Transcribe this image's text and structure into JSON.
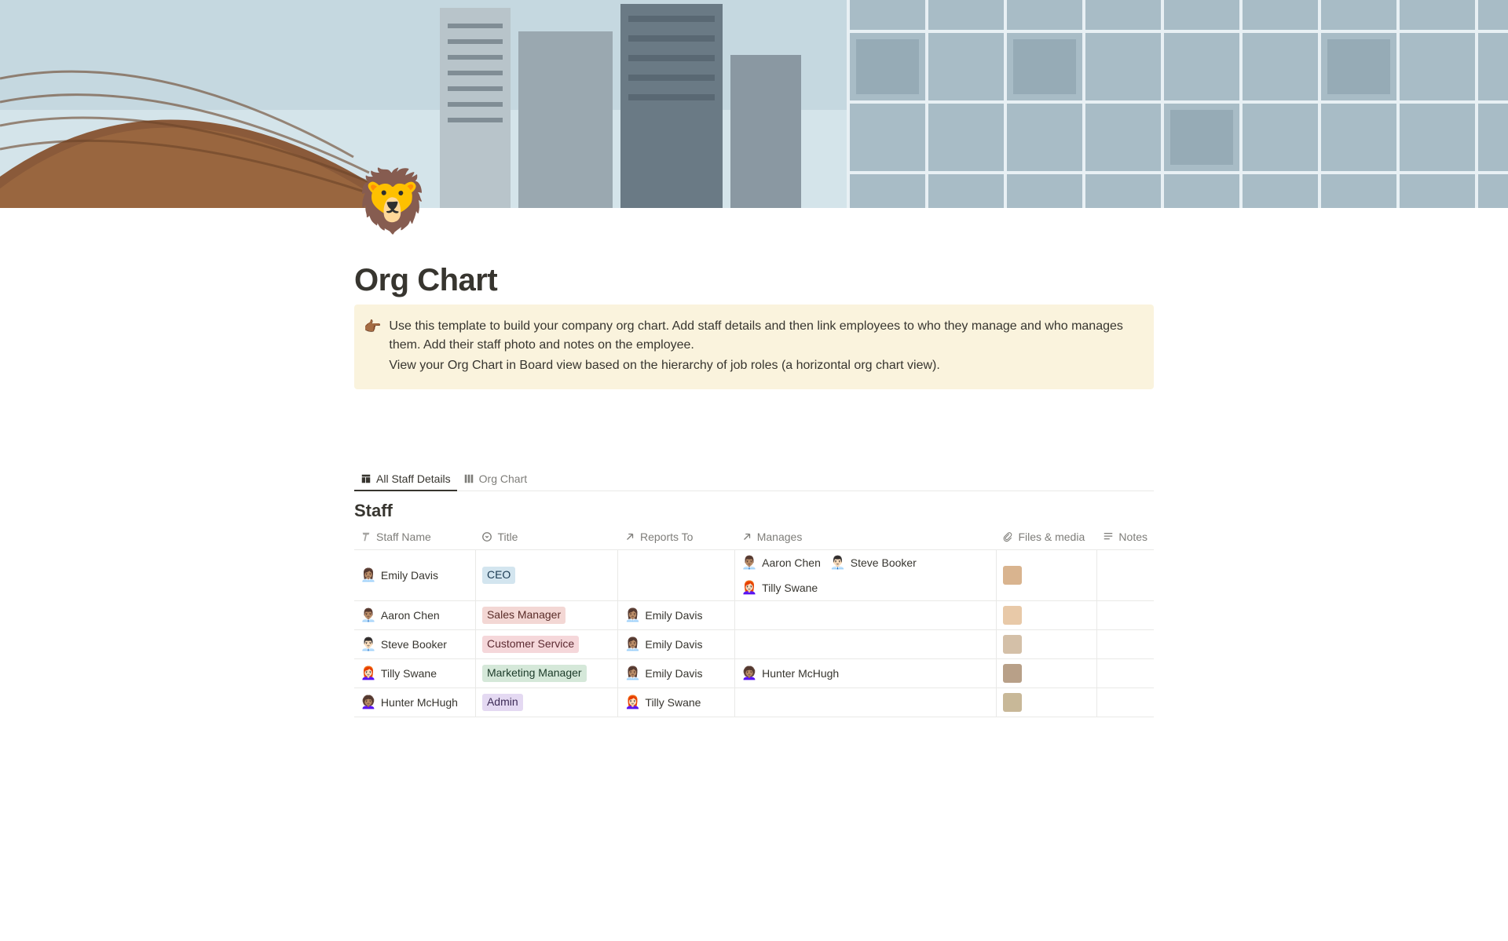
{
  "page": {
    "icon": "🦁",
    "title": "Org Chart"
  },
  "callout": {
    "icon": "👉🏾",
    "line1": "Use this template to build your company org chart. Add staff details and then link employees to who they manage and who manages them. Add their staff photo and notes on the employee.",
    "line2": "View your Org Chart in Board view based on the hierarchy of job roles (a horizontal org chart view)."
  },
  "tabs": {
    "t0": "All Staff Details",
    "t1": "Org Chart"
  },
  "section": {
    "title": "Staff"
  },
  "columns": {
    "name": "Staff Name",
    "title": "Title",
    "reports": "Reports To",
    "manages": "Manages",
    "files": "Files & media",
    "notes": "Notes"
  },
  "rows": [
    {
      "emoji": "👩🏽‍💼",
      "name": "Emily Davis",
      "title": "CEO",
      "titleClass": "tag-blue",
      "reports_emoji": "",
      "reports": "",
      "manages": [
        {
          "emoji": "👨🏽‍💼",
          "name": "Aaron Chen"
        },
        {
          "emoji": "👨🏻‍💼",
          "name": "Steve Booker"
        },
        {
          "emoji": "👩🏻‍🦰",
          "name": "Tilly Swane"
        }
      ],
      "avatar": "#d9b48f"
    },
    {
      "emoji": "👨🏽‍💼",
      "name": "Aaron Chen",
      "title": "Sales Manager",
      "titleClass": "tag-salmon",
      "reports_emoji": "👩🏽‍💼",
      "reports": "Emily Davis",
      "manages": [],
      "avatar": "#e8c9a8"
    },
    {
      "emoji": "👨🏻‍💼",
      "name": "Steve Booker",
      "title": "Customer Service",
      "titleClass": "tag-pink",
      "reports_emoji": "👩🏽‍💼",
      "reports": "Emily Davis",
      "manages": [],
      "avatar": "#d4c0a8"
    },
    {
      "emoji": "👩🏻‍🦰",
      "name": "Tilly Swane",
      "title": "Marketing Manager",
      "titleClass": "tag-green",
      "reports_emoji": "👩🏽‍💼",
      "reports": "Emily Davis",
      "manages": [
        {
          "emoji": "👩🏽‍🦱",
          "name": "Hunter McHugh"
        }
      ],
      "avatar": "#b8a088"
    },
    {
      "emoji": "👩🏽‍🦱",
      "name": "Hunter McHugh",
      "title": "Admin",
      "titleClass": "tag-purple",
      "reports_emoji": "👩🏻‍🦰",
      "reports": "Tilly Swane",
      "manages": [],
      "avatar": "#c8b898"
    }
  ]
}
